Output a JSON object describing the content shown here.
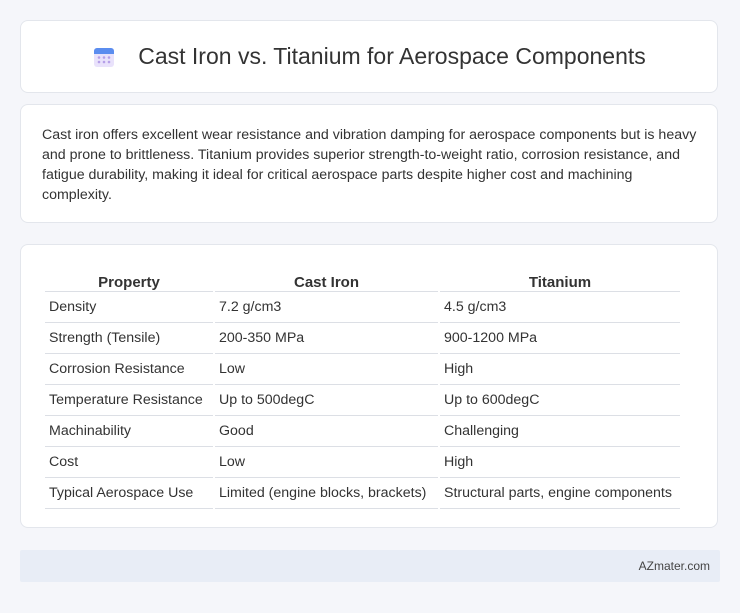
{
  "header": {
    "title": "Cast Iron vs. Titanium for Aerospace Components",
    "icon": "calendar-icon"
  },
  "summary": {
    "text": "Cast iron offers excellent wear resistance and vibration damping for aerospace components but is heavy and prone to brittleness. Titanium provides superior strength-to-weight ratio, corrosion resistance, and fatigue durability, making it ideal for critical aerospace parts despite higher cost and machining complexity."
  },
  "table": {
    "headers": [
      "Property",
      "Cast Iron",
      "Titanium"
    ],
    "rows": [
      [
        "Density",
        "7.2 g/cm3",
        "4.5 g/cm3"
      ],
      [
        "Strength (Tensile)",
        "200-350 MPa",
        "900-1200 MPa"
      ],
      [
        "Corrosion Resistance",
        "Low",
        "High"
      ],
      [
        "Temperature Resistance",
        "Up to 500degC",
        "Up to 600degC"
      ],
      [
        "Machinability",
        "Good",
        "Challenging"
      ],
      [
        "Cost",
        "Low",
        "High"
      ],
      [
        "Typical Aerospace Use",
        "Limited (engine blocks, brackets)",
        "Structural parts, engine components"
      ]
    ]
  },
  "footer": {
    "brand": "AZmater.com"
  },
  "colors": {
    "icon_header": "#5b8def",
    "icon_body": "#c9b8f0",
    "footer_bg": "#e8edf6"
  }
}
